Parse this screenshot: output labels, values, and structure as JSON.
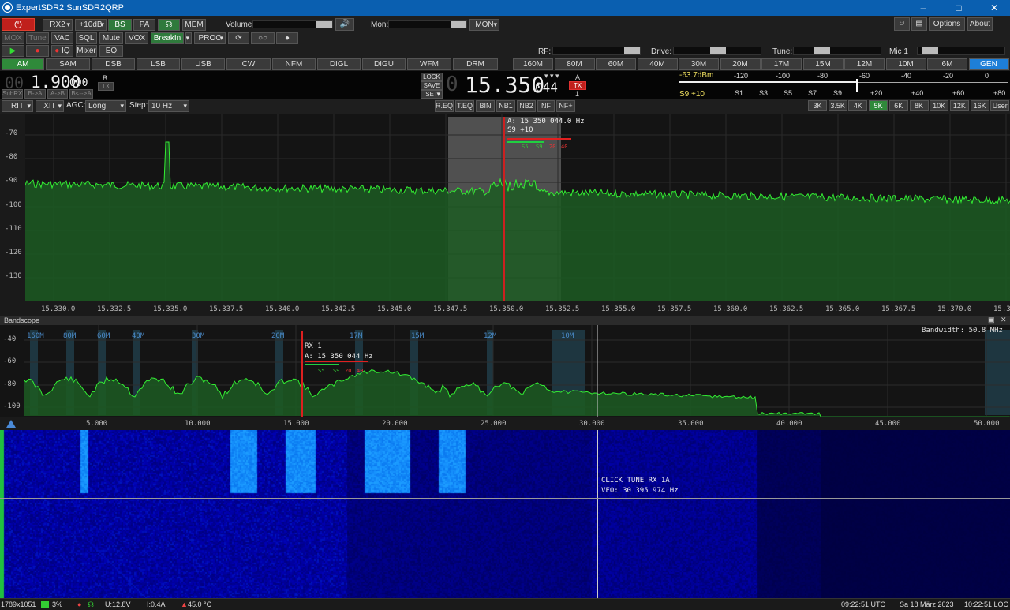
{
  "window": {
    "title": "ExpertSDR2 SunSDR2QRP"
  },
  "toolbar1": {
    "rx2": "RX2",
    "gain": "+10dB",
    "bs": "BS",
    "pa": "PA",
    "mem": "MEM",
    "volume_label": "Volume:",
    "mon_label": "Mon:",
    "mon_btn": "MON",
    "options": "Options",
    "about": "About"
  },
  "toolbar2": {
    "mox": "MOX",
    "tune": "Tune",
    "vac": "VAC",
    "sql": "SQL",
    "mute": "Mute",
    "vox": "VOX",
    "breakin": "BreakIn",
    "proc": "PROC",
    "rf_label": "RF:",
    "drive_label": "Drive:",
    "tune_label": "Tune:",
    "mic_label": "Mic 1"
  },
  "toolbar3": {
    "iq": "IQ",
    "mixer": "Mixer",
    "eq": "EQ"
  },
  "modes": [
    "AM",
    "SAM",
    "DSB",
    "LSB",
    "USB",
    "CW",
    "NFM",
    "DIGL",
    "DIGU",
    "WFM",
    "DRM"
  ],
  "bands": [
    "160M",
    "80M",
    "60M",
    "40M",
    "30M",
    "20M",
    "17M",
    "15M",
    "12M",
    "10M",
    "6M",
    "GEN"
  ],
  "vfo_b": {
    "lead": "00",
    "freq_main": "1.900",
    "freq_sub": "000",
    "label": "B",
    "tx": "TX",
    "subrx": "SubRX",
    "b_a": "B->A",
    "a_b": "A->B",
    "swap": "B<-->A"
  },
  "vfo_a": {
    "lock": "LOCK",
    "save": "SAVE",
    "set": "SET",
    "lead": "0",
    "freq_main": "15.350",
    "freq_sub": "044",
    "label": "A",
    "tx": "TX",
    "rx": "1"
  },
  "smeter": {
    "dbm": "-63.7dBm",
    "reading": "S9 +10",
    "scale_top": [
      "-120",
      "-100",
      "-80",
      "-60",
      "-40",
      "-20",
      "0"
    ],
    "scale_bottom": [
      "S1",
      "S3",
      "S5",
      "S7",
      "S9",
      "+20",
      "+40",
      "+60",
      "+80"
    ]
  },
  "row6": {
    "rit": "RIT",
    "xit": "XIT",
    "agc_label": "AGC:",
    "agc_value": "Long",
    "step_label": "Step:",
    "step_value": "10 Hz",
    "dsp": [
      "R.EQ",
      "T.EQ",
      "BIN",
      "NB1",
      "NB2",
      "NF",
      "NF+"
    ],
    "bandwidths": [
      "3K",
      "3.5K",
      "4K",
      "5K",
      "6K",
      "8K",
      "10K",
      "12K",
      "16K",
      "User"
    ]
  },
  "spectrum": {
    "db_ticks": [
      "-70",
      "-80",
      "-90",
      "-100",
      "-110",
      "-120",
      "-130"
    ],
    "freq_ticks": [
      "15.330.0",
      "15.332.5",
      "15.335.0",
      "15.337.5",
      "15.340.0",
      "15.342.5",
      "15.345.0",
      "15.347.5",
      "15.350.0",
      "15.352.5",
      "15.355.0",
      "15.357.5",
      "15.360.0",
      "15.362.5",
      "15.365.0",
      "15.367.5",
      "15.370.0",
      "15.3"
    ],
    "marker_freq": "A: 15 350 044.0 Hz",
    "marker_s": "S9 +10",
    "mini_scale": [
      "S5",
      "S9",
      "20",
      "40"
    ]
  },
  "bandscope": {
    "title": "Bandscope",
    "bandwidth": "Bandwidth: 50.8 MHz",
    "db_ticks": [
      "-40",
      "-60",
      "-80",
      "-100"
    ],
    "band_labels": [
      "160M",
      "80M",
      "60M",
      "40M",
      "30M",
      "20M",
      "17M",
      "15M",
      "12M",
      "10M"
    ],
    "freq_ticks": [
      "5.000",
      "10.000",
      "15.000",
      "20.000",
      "25.000",
      "30.000",
      "35.000",
      "40.000",
      "45.000",
      "50.000"
    ],
    "rx_label": "RX 1",
    "rx_freq": "A: 15 350 044 Hz",
    "mini_scale": [
      "S5",
      "S9",
      "20",
      "40"
    ]
  },
  "waterfall": {
    "click_tune": "CLICK TUNE RX 1A",
    "vfo": "VFO: 30 395 974 Hz"
  },
  "status": {
    "resolution": "1789x1051",
    "cpu": "3%",
    "voltage": "U:12.8V",
    "current": "I:0.4A",
    "temp": "45.0 °C",
    "utc": "09:22:51 UTC",
    "date": "Sa 18 März 2023",
    "loc": "10:22:51 LOC"
  },
  "colors": {
    "spectrum": "#33ee33",
    "accent_green": "#2f8a3a",
    "accent_blue": "#1e7fd8",
    "title_bar": "#0a5fb0",
    "marker": "#cc2020"
  }
}
